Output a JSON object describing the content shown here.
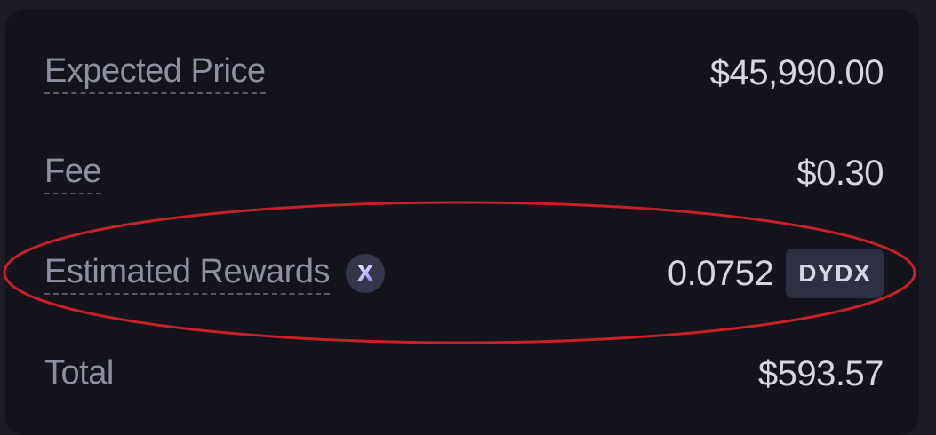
{
  "rows": {
    "expected_price": {
      "label": "Expected Price",
      "value": "$45,990.00"
    },
    "fee": {
      "label": "Fee",
      "value": "$0.30"
    },
    "estimated_rewards": {
      "label": "Estimated Rewards",
      "icon": "x-token-icon",
      "icon_glyph": "X",
      "value": "0.0752",
      "token": "DYDX"
    },
    "total": {
      "label": "Total",
      "value": "$593.57"
    }
  },
  "colors": {
    "background": "#14141c",
    "label": "#8f8fa2",
    "value": "#d6d6e2",
    "badge": "#2f2f42",
    "annotation": "#c8202a"
  }
}
